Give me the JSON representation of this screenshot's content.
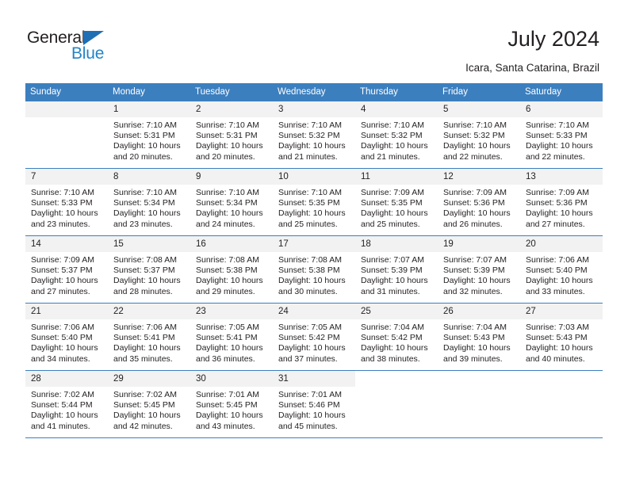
{
  "brand": {
    "name_dark": "General",
    "name_blue": "Blue",
    "triangle_color": "#1f6fb5",
    "blue_color": "#2484c6"
  },
  "header": {
    "title": "July 2024",
    "subtitle": "Icara, Santa Catarina, Brazil"
  },
  "theme": {
    "header_row_bg": "#3c7fbf",
    "day_number_bg": "#f2f2f2",
    "text_color": "#231f20"
  },
  "weekday_headers": [
    "Sunday",
    "Monday",
    "Tuesday",
    "Wednesday",
    "Thursday",
    "Friday",
    "Saturday"
  ],
  "weeks": [
    [
      {
        "day": "",
        "sunrise": "",
        "sunset": "",
        "daylight_line1": "",
        "daylight_line2": ""
      },
      {
        "day": "1",
        "sunrise": "Sunrise: 7:10 AM",
        "sunset": "Sunset: 5:31 PM",
        "daylight_line1": "Daylight: 10 hours",
        "daylight_line2": "and 20 minutes."
      },
      {
        "day": "2",
        "sunrise": "Sunrise: 7:10 AM",
        "sunset": "Sunset: 5:31 PM",
        "daylight_line1": "Daylight: 10 hours",
        "daylight_line2": "and 20 minutes."
      },
      {
        "day": "3",
        "sunrise": "Sunrise: 7:10 AM",
        "sunset": "Sunset: 5:32 PM",
        "daylight_line1": "Daylight: 10 hours",
        "daylight_line2": "and 21 minutes."
      },
      {
        "day": "4",
        "sunrise": "Sunrise: 7:10 AM",
        "sunset": "Sunset: 5:32 PM",
        "daylight_line1": "Daylight: 10 hours",
        "daylight_line2": "and 21 minutes."
      },
      {
        "day": "5",
        "sunrise": "Sunrise: 7:10 AM",
        "sunset": "Sunset: 5:32 PM",
        "daylight_line1": "Daylight: 10 hours",
        "daylight_line2": "and 22 minutes."
      },
      {
        "day": "6",
        "sunrise": "Sunrise: 7:10 AM",
        "sunset": "Sunset: 5:33 PM",
        "daylight_line1": "Daylight: 10 hours",
        "daylight_line2": "and 22 minutes."
      }
    ],
    [
      {
        "day": "7",
        "sunrise": "Sunrise: 7:10 AM",
        "sunset": "Sunset: 5:33 PM",
        "daylight_line1": "Daylight: 10 hours",
        "daylight_line2": "and 23 minutes."
      },
      {
        "day": "8",
        "sunrise": "Sunrise: 7:10 AM",
        "sunset": "Sunset: 5:34 PM",
        "daylight_line1": "Daylight: 10 hours",
        "daylight_line2": "and 23 minutes."
      },
      {
        "day": "9",
        "sunrise": "Sunrise: 7:10 AM",
        "sunset": "Sunset: 5:34 PM",
        "daylight_line1": "Daylight: 10 hours",
        "daylight_line2": "and 24 minutes."
      },
      {
        "day": "10",
        "sunrise": "Sunrise: 7:10 AM",
        "sunset": "Sunset: 5:35 PM",
        "daylight_line1": "Daylight: 10 hours",
        "daylight_line2": "and 25 minutes."
      },
      {
        "day": "11",
        "sunrise": "Sunrise: 7:09 AM",
        "sunset": "Sunset: 5:35 PM",
        "daylight_line1": "Daylight: 10 hours",
        "daylight_line2": "and 25 minutes."
      },
      {
        "day": "12",
        "sunrise": "Sunrise: 7:09 AM",
        "sunset": "Sunset: 5:36 PM",
        "daylight_line1": "Daylight: 10 hours",
        "daylight_line2": "and 26 minutes."
      },
      {
        "day": "13",
        "sunrise": "Sunrise: 7:09 AM",
        "sunset": "Sunset: 5:36 PM",
        "daylight_line1": "Daylight: 10 hours",
        "daylight_line2": "and 27 minutes."
      }
    ],
    [
      {
        "day": "14",
        "sunrise": "Sunrise: 7:09 AM",
        "sunset": "Sunset: 5:37 PM",
        "daylight_line1": "Daylight: 10 hours",
        "daylight_line2": "and 27 minutes."
      },
      {
        "day": "15",
        "sunrise": "Sunrise: 7:08 AM",
        "sunset": "Sunset: 5:37 PM",
        "daylight_line1": "Daylight: 10 hours",
        "daylight_line2": "and 28 minutes."
      },
      {
        "day": "16",
        "sunrise": "Sunrise: 7:08 AM",
        "sunset": "Sunset: 5:38 PM",
        "daylight_line1": "Daylight: 10 hours",
        "daylight_line2": "and 29 minutes."
      },
      {
        "day": "17",
        "sunrise": "Sunrise: 7:08 AM",
        "sunset": "Sunset: 5:38 PM",
        "daylight_line1": "Daylight: 10 hours",
        "daylight_line2": "and 30 minutes."
      },
      {
        "day": "18",
        "sunrise": "Sunrise: 7:07 AM",
        "sunset": "Sunset: 5:39 PM",
        "daylight_line1": "Daylight: 10 hours",
        "daylight_line2": "and 31 minutes."
      },
      {
        "day": "19",
        "sunrise": "Sunrise: 7:07 AM",
        "sunset": "Sunset: 5:39 PM",
        "daylight_line1": "Daylight: 10 hours",
        "daylight_line2": "and 32 minutes."
      },
      {
        "day": "20",
        "sunrise": "Sunrise: 7:06 AM",
        "sunset": "Sunset: 5:40 PM",
        "daylight_line1": "Daylight: 10 hours",
        "daylight_line2": "and 33 minutes."
      }
    ],
    [
      {
        "day": "21",
        "sunrise": "Sunrise: 7:06 AM",
        "sunset": "Sunset: 5:40 PM",
        "daylight_line1": "Daylight: 10 hours",
        "daylight_line2": "and 34 minutes."
      },
      {
        "day": "22",
        "sunrise": "Sunrise: 7:06 AM",
        "sunset": "Sunset: 5:41 PM",
        "daylight_line1": "Daylight: 10 hours",
        "daylight_line2": "and 35 minutes."
      },
      {
        "day": "23",
        "sunrise": "Sunrise: 7:05 AM",
        "sunset": "Sunset: 5:41 PM",
        "daylight_line1": "Daylight: 10 hours",
        "daylight_line2": "and 36 minutes."
      },
      {
        "day": "24",
        "sunrise": "Sunrise: 7:05 AM",
        "sunset": "Sunset: 5:42 PM",
        "daylight_line1": "Daylight: 10 hours",
        "daylight_line2": "and 37 minutes."
      },
      {
        "day": "25",
        "sunrise": "Sunrise: 7:04 AM",
        "sunset": "Sunset: 5:42 PM",
        "daylight_line1": "Daylight: 10 hours",
        "daylight_line2": "and 38 minutes."
      },
      {
        "day": "26",
        "sunrise": "Sunrise: 7:04 AM",
        "sunset": "Sunset: 5:43 PM",
        "daylight_line1": "Daylight: 10 hours",
        "daylight_line2": "and 39 minutes."
      },
      {
        "day": "27",
        "sunrise": "Sunrise: 7:03 AM",
        "sunset": "Sunset: 5:43 PM",
        "daylight_line1": "Daylight: 10 hours",
        "daylight_line2": "and 40 minutes."
      }
    ],
    [
      {
        "day": "28",
        "sunrise": "Sunrise: 7:02 AM",
        "sunset": "Sunset: 5:44 PM",
        "daylight_line1": "Daylight: 10 hours",
        "daylight_line2": "and 41 minutes."
      },
      {
        "day": "29",
        "sunrise": "Sunrise: 7:02 AM",
        "sunset": "Sunset: 5:45 PM",
        "daylight_line1": "Daylight: 10 hours",
        "daylight_line2": "and 42 minutes."
      },
      {
        "day": "30",
        "sunrise": "Sunrise: 7:01 AM",
        "sunset": "Sunset: 5:45 PM",
        "daylight_line1": "Daylight: 10 hours",
        "daylight_line2": "and 43 minutes."
      },
      {
        "day": "31",
        "sunrise": "Sunrise: 7:01 AM",
        "sunset": "Sunset: 5:46 PM",
        "daylight_line1": "Daylight: 10 hours",
        "daylight_line2": "and 45 minutes."
      },
      {
        "day": "",
        "sunrise": "",
        "sunset": "",
        "daylight_line1": "",
        "daylight_line2": ""
      },
      {
        "day": "",
        "sunrise": "",
        "sunset": "",
        "daylight_line1": "",
        "daylight_line2": ""
      },
      {
        "day": "",
        "sunrise": "",
        "sunset": "",
        "daylight_line1": "",
        "daylight_line2": ""
      }
    ]
  ]
}
